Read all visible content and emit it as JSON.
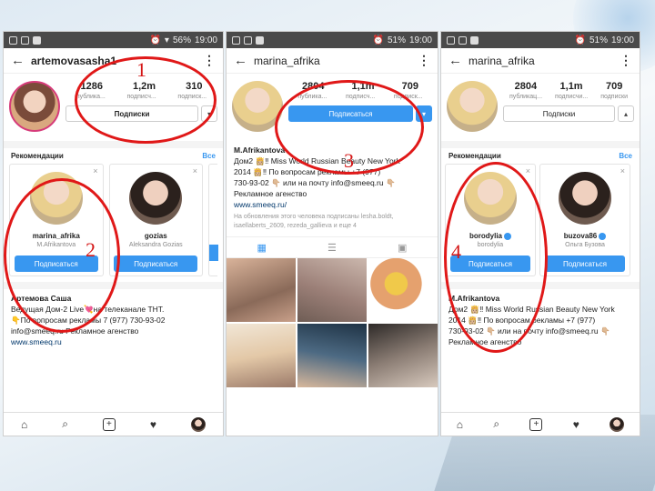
{
  "status": {
    "battery": "56%",
    "battery2": "51%",
    "time": "19:00"
  },
  "phone1": {
    "username": "artemovasasha1",
    "counts": [
      "1286",
      "1,2m",
      "310"
    ],
    "count_labels": [
      "публика...",
      "подписч...",
      "подписк..."
    ],
    "subscriptions_label": "Подписки",
    "recommendations_label": "Рекомендации",
    "see_all": "Все",
    "cards": [
      {
        "name": "marina_afrika",
        "sub": "M.Afrikantova",
        "follow": "Подписаться"
      },
      {
        "name": "gozias",
        "sub": "Aleksandra Gozias",
        "follow": "Подписаться"
      }
    ],
    "bio": [
      "Артемова Саша",
      "Ведущая Дом-2 Live💘на телеканале ТНТ.",
      "👇По вопросам рекламы 7 (977) 730-93-02",
      "info@smeeq.ru Рекламное агенство",
      "www.smeeq.ru"
    ]
  },
  "phone2": {
    "username": "marina_afrika",
    "counts": [
      "2804",
      "1,1m",
      "709"
    ],
    "count_labels": [
      "публика...",
      "подписч...",
      "подписк..."
    ],
    "follow_label": "Подписаться",
    "bio_name": "M.Afrikantova",
    "bio": [
      "Дом2 👸🏼‼ Miss World Russian Beauty New York",
      "2014 👸🏼‼ По вопросам рекламы +7 (977)",
      "730-93-02 👇🏼 или на почту info@smeeq.ru 👇🏼",
      "Рекламное агенство"
    ],
    "link": "www.smeeq.ru/",
    "followed_by": "На обновления этого человека подписаны lesha.boldt, isaellaberts_2609, rezeda_gallieva и еще 4"
  },
  "phone3": {
    "username": "marina_afrika",
    "counts": [
      "2804",
      "1,1m",
      "709"
    ],
    "count_labels": [
      "публикац...",
      "подписчи...",
      "подписки"
    ],
    "subscriptions_label": "Подписки",
    "recommendations_label": "Рекомендации",
    "see_all": "Все",
    "cards": [
      {
        "name": "borodylia",
        "sub": "borodylia",
        "follow": "Подписаться"
      },
      {
        "name": "buzova86",
        "sub": "Ольга Бузова",
        "follow": "Подписаться"
      }
    ],
    "bio_name": "M.Afrikantova",
    "bio": [
      "Дом2 👸🏼‼ Miss World Russian Beauty New York",
      "2014 👸🏼‼ По вопросам рекламы +7 (977)",
      "730-93-02 👇🏼 или на почту info@smeeq.ru 👇🏼",
      "Рекламное агенство"
    ]
  },
  "annotations": [
    "1",
    "2",
    "3",
    "4"
  ],
  "colors": {
    "accent": "#3897f0",
    "annotation": "#e01818"
  }
}
